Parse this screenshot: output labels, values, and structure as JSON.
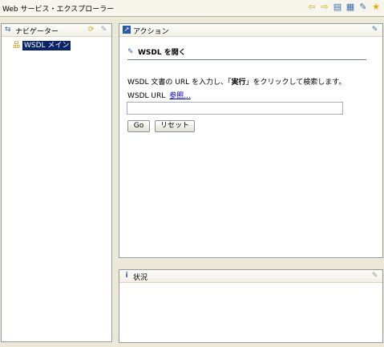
{
  "window": {
    "title": "Web サービス・エクスプローラー"
  },
  "toolbar": {
    "icons": [
      {
        "name": "back-arrow-icon",
        "glyph": "⇦",
        "color": "#d9a400"
      },
      {
        "name": "forward-arrow-icon",
        "glyph": "⇨",
        "color": "#d9a400"
      },
      {
        "name": "uddi-page-icon",
        "glyph": "▤",
        "color": "#3a6fb0"
      },
      {
        "name": "wsil-page-icon",
        "glyph": "▦",
        "color": "#3a6fb0"
      },
      {
        "name": "wsdl-page-icon",
        "glyph": "✎",
        "color": "#3a6fb0"
      },
      {
        "name": "favorites-star-icon",
        "glyph": "★",
        "color": "#f0a800"
      }
    ]
  },
  "navigator": {
    "title": "ナビゲーター",
    "tree": [
      {
        "label": "WSDL メイン"
      }
    ]
  },
  "actions": {
    "title": "アクション",
    "section_title": "WSDL を開く",
    "description_prefix": "WSDL 文書の URL を入力し、「",
    "description_bold": "実行",
    "description_suffix": "」をクリックして検索します。",
    "url_label": "WSDL URL",
    "browse_link": "参照...",
    "url_value": "",
    "go_label": "Go",
    "reset_label": "リセット"
  },
  "status": {
    "title": "状況"
  }
}
